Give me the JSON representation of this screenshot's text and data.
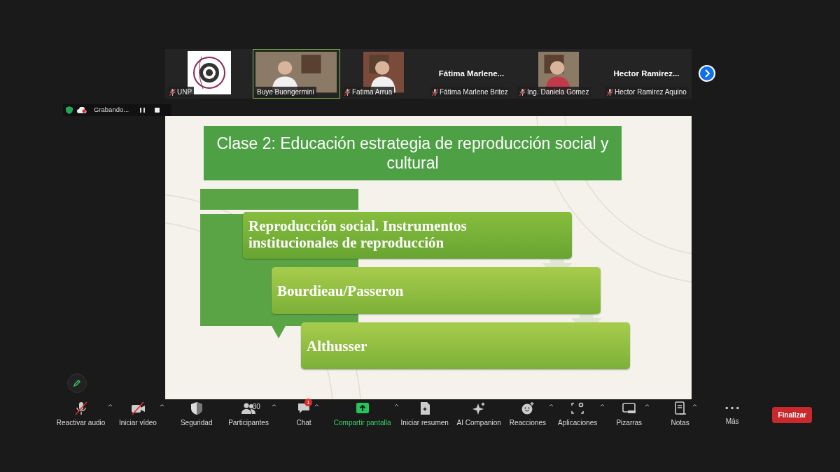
{
  "participants": [
    {
      "name": "UNP",
      "kind": "logo",
      "muted": true,
      "speaking": false
    },
    {
      "name": "Buye Buongermini",
      "kind": "video",
      "muted": false,
      "speaking": true
    },
    {
      "name": "Fatima Arrua",
      "kind": "video",
      "muted": true,
      "speaking": false
    },
    {
      "name": "Fátima Marlene Britez",
      "kind": "name",
      "display": "Fátima  Marlene...",
      "muted": true,
      "speaking": false
    },
    {
      "name": "Ing. Daniela Gomez",
      "kind": "video",
      "muted": true,
      "speaking": false
    },
    {
      "name": "Hector Ramirez Aquino",
      "kind": "name",
      "display": "Hector  Ramirez...",
      "muted": true,
      "speaking": false
    }
  ],
  "recording": {
    "label": "Grabando..."
  },
  "slide": {
    "title": "Clase 2: Educación estrategia de reproducción social y cultural",
    "steps": [
      "Reproducción social. Instrumentos institucionales de reproducción",
      "Bourdieau/Passeron",
      "Althusser"
    ]
  },
  "toolbar": [
    {
      "label": "Reactivar audio",
      "kind": "mic",
      "off": true,
      "caret": true,
      "accent": false
    },
    {
      "label": "Iniciar vídeo",
      "kind": "camera",
      "off": true,
      "caret": true,
      "accent": false
    },
    {
      "label": "Seguridad",
      "kind": "shield",
      "off": false,
      "caret": false,
      "accent": false
    },
    {
      "label": "Participantes",
      "kind": "people",
      "off": false,
      "caret": true,
      "count": "30",
      "accent": false
    },
    {
      "label": "Chat",
      "kind": "chat",
      "off": false,
      "caret": true,
      "badge": "1",
      "accent": false
    },
    {
      "label": "Compartir pantalla",
      "kind": "share",
      "off": false,
      "caret": true,
      "accent": true
    },
    {
      "label": "Iniciar resumen",
      "kind": "doc",
      "off": false,
      "caret": false,
      "accent": false
    },
    {
      "label": "AI Companion",
      "kind": "sparkle",
      "off": false,
      "caret": false,
      "accent": false
    },
    {
      "label": "Reacciones",
      "kind": "smile",
      "off": false,
      "caret": true,
      "accent": false
    },
    {
      "label": "Aplicaciones",
      "kind": "apps",
      "off": false,
      "caret": true,
      "accent": false
    },
    {
      "label": "Pizarras",
      "kind": "board",
      "off": false,
      "caret": true,
      "accent": false
    },
    {
      "label": "Notas",
      "kind": "notes",
      "off": false,
      "caret": true,
      "accent": false
    },
    {
      "label": "Más",
      "kind": "more",
      "off": false,
      "caret": false,
      "accent": false
    }
  ],
  "end_button": "Finalizar"
}
